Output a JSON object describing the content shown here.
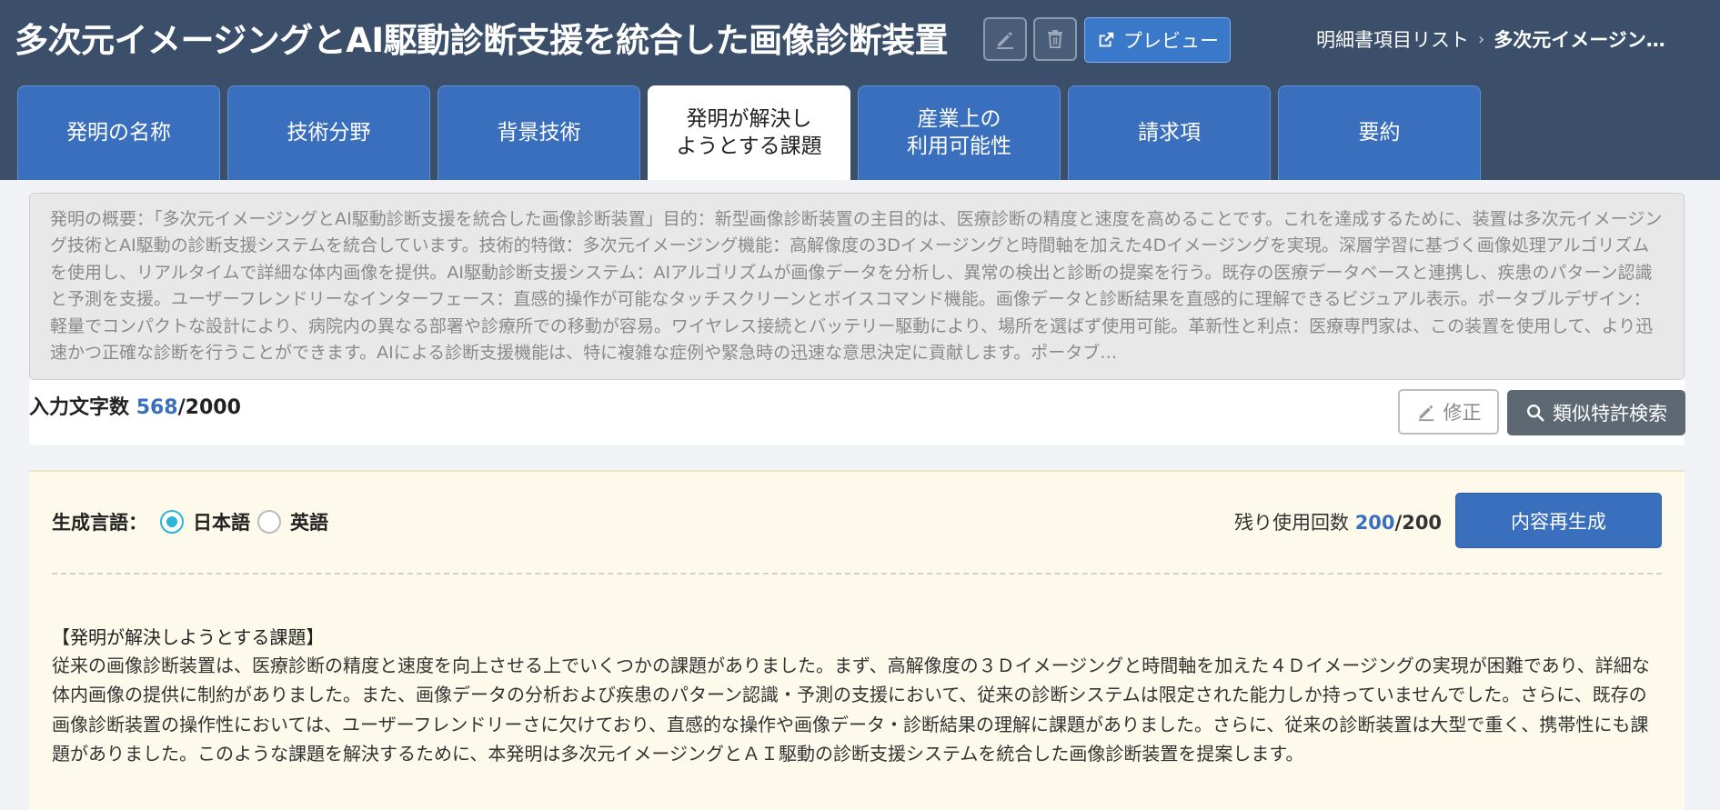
{
  "header": {
    "title": "多次元イメージングとAI駆動診断支援を統合した画像診断装置",
    "preview_label": "プレビュー",
    "breadcrumb": {
      "parent": "明細書項目リスト",
      "separator": "›",
      "current": "多次元イメージン…"
    }
  },
  "tabs": [
    {
      "label": "発明の名称",
      "active": false
    },
    {
      "label": "技術分野",
      "active": false
    },
    {
      "label": "背景技術",
      "active": false
    },
    {
      "label": "発明が解決し\nようとする課題",
      "active": true
    },
    {
      "label": "産業上の\n利用可能性",
      "active": false
    },
    {
      "label": "請求項",
      "active": false
    },
    {
      "label": "要約",
      "active": false
    }
  ],
  "summary": {
    "text": "発明の概要：「多次元イメージングとAI駆動診断支援を統合した画像診断装置」目的：新型画像診断装置の主目的は、医療診断の精度と速度を高めることです。これを達成するために、装置は多次元イメージング技術とAI駆動の診断支援システムを統合しています。技術的特徴：多次元イメージング機能：高解像度の3Dイメージングと時間軸を加えた4Dイメージングを実現。深層学習に基づく画像処理アルゴリズムを使用し、リアルタイムで詳細な体内画像を提供。AI駆動診断支援システム：AIアルゴリズムが画像データを分析し、異常の検出と診断の提案を行う。既存の医療データベースと連携し、疾患のパターン認識と予測を支援。ユーザーフレンドリーなインターフェース：直感的操作が可能なタッチスクリーンとボイスコマンド機能。画像データと診断結果を直感的に理解できるビジュアル表示。ポータブルデザイン：軽量でコンパクトな設計により、病院内の異なる部署や診療所での移動が容易。ワイヤレス接続とバッテリー駆動により、場所を選ばず使用可能。革新性と利点：医療専門家は、この装置を使用して、より迅速かつ正確な診断を行うことができます。AIによる診断支援機能は、特に複雑な症例や緊急時の迅速な意思決定に貢献します。ポータブ…",
    "char_count_label": "入力文字数",
    "char_count": "568",
    "char_max": "/2000",
    "edit_label": "修正",
    "search_label": "類似特許検索"
  },
  "generation": {
    "language_label": "生成言語：",
    "options": [
      "日本語",
      "英語"
    ],
    "selected": "日本語",
    "remaining_label": "残り使用回数",
    "remaining": "200",
    "remaining_max": "/200",
    "regen_label": "内容再生成",
    "result_title": "【発明が解決しようとする課題】",
    "result_body": "従来の画像診断装置は、医療診断の精度と速度を向上させる上でいくつかの課題がありました。まず、高解像度の３Ｄイメージングと時間軸を加えた４Ｄイメージングの実現が困難であり、詳細な体内画像の提供に制約がありました。また、画像データの分析および疾患のパターン認識・予測の支援において、従来の診断システムは限定された能力しか持っていませんでした。さらに、既存の画像診断装置の操作性においては、ユーザーフレンドリーさに欠けており、直感的な操作や画像データ・診断結果の理解に課題がありました。さらに、従来の診断装置は大型で重く、携帯性にも課題がありました。このような課題を解決するために、本発明は多次元イメージングとＡＩ駆動の診断支援システムを統合した画像診断装置を提案します。"
  },
  "colors": {
    "header_bg": "#3b4f6b",
    "tab_bg": "#3a6fbe",
    "accent": "#3a6fbe",
    "radio_checked": "#2bb6d4",
    "panel_bg": "#fdfaec"
  }
}
